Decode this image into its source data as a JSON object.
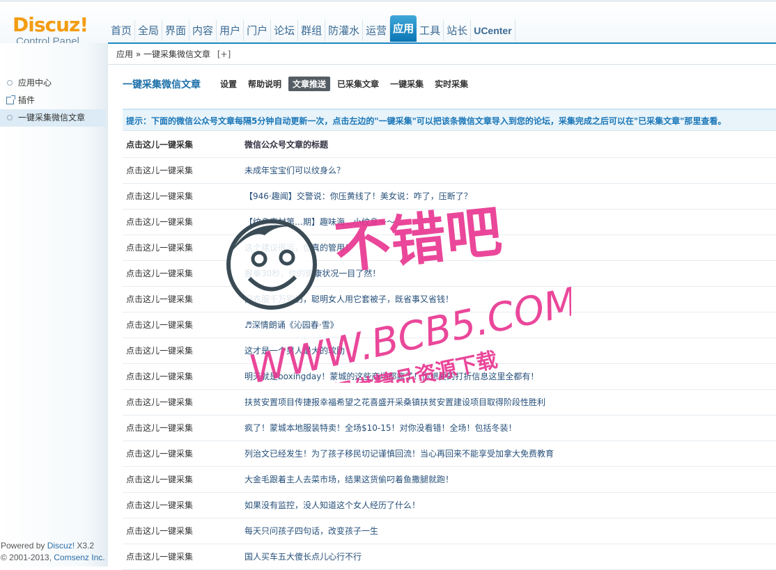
{
  "logo": {
    "main": "Discuz!",
    "sub": "Control Panel"
  },
  "topnav": [
    "首页",
    "全局",
    "界面",
    "内容",
    "用户",
    "门户",
    "论坛",
    "群组",
    "防灌水",
    "运营",
    "应用",
    "工具",
    "站长",
    "UCenter"
  ],
  "topnav_active": "应用",
  "sidebar": {
    "items": [
      "应用中心",
      "插件",
      "一键采集微信文章"
    ]
  },
  "breadcrumb": {
    "app": "应用",
    "sep": "»",
    "current": "一键采集微信文章",
    "add": "[+]"
  },
  "page": {
    "title": "一键采集微信文章"
  },
  "tabs": [
    "设置",
    "帮助说明",
    "文章推送",
    "已采集文章",
    "一键采集",
    "实时采集"
  ],
  "tab_active": "文章推送",
  "tip": "提示：下面的微信公众号文章每隔5分钟自动更新一次，点击左边的\"一键采集\"可以把该条微信文章导入到您的论坛，采集完成之后可以在\"已采集文章\"那里查看。",
  "table": {
    "headers": [
      "点击这儿一键采集",
      "微信公众号文章的标题"
    ],
    "rows": [
      {
        "action": "点击这儿一键采集",
        "title": "未成年宝宝们可以纹身么？"
      },
      {
        "action": "点击这儿一键采集",
        "title": "【946·趣闻】交警说：你压黄线了！美女说：咋了，压断了？"
      },
      {
        "action": "点击这儿一键采集",
        "title": "【纹身素材第…期】趣味海…小纹身～～"
      },
      {
        "action": "点击这儿一键采集",
        "title": "这个建议很污，但真的管用！"
      },
      {
        "action": "点击这儿一键采集",
        "title": "握拳30秒，你的健康状况一目了然！"
      },
      {
        "action": "点击这儿一键采集",
        "title": "旧衣服千万别扔，聪明女人用它套被子，既省事又省钱！"
      },
      {
        "action": "点击这儿一键采集",
        "title": "♬深情朗诵《沁园春·雪》"
      },
      {
        "action": "点击这儿一键采集",
        "title": "这才是一个男人最大的软肋"
      },
      {
        "action": "点击这儿一键采集",
        "title": "明天就是boxingday！蒙城的这些商场都疯了！你想要的打折信息这里全都有！"
      },
      {
        "action": "点击这儿一键采集",
        "title": "扶贫安置项目传捷报幸福希望之花喜盛开采桑镇扶贫安置建设项目取得阶段性胜利"
      },
      {
        "action": "点击这儿一键采集",
        "title": "疯了！蒙城本地服装特卖！全场$10-15！对你没看错！全场！包括冬装！"
      },
      {
        "action": "点击这儿一键采集",
        "title": "列治文已经发生！为了孩子移民切记谨慎回流！当心再回来不能享受加拿大免费教育"
      },
      {
        "action": "点击这儿一键采集",
        "title": "大金毛跟着主人去菜市场，结果这货偷叼着鱼撒腿就跑！"
      },
      {
        "action": "点击这儿一键采集",
        "title": "如果没有监控，没人知道这个女人经历了什么！"
      },
      {
        "action": "点击这儿一键采集",
        "title": "每天只问孩子四句话，改变孩子一生"
      },
      {
        "action": "点击这儿一键采集",
        "title": "国人买车五大傻长点儿心行不行"
      }
    ]
  },
  "footer": {
    "powered": "Powered by",
    "product": "Discuz!",
    "version": "X3.2",
    "copyright": "© 2001-2013,",
    "company": "Comsenz Inc."
  },
  "watermark": {
    "line1": "不错吧",
    "line2": "WWW.BCB5.COM",
    "line3": "免费提供精品资源下载"
  },
  "colors": {
    "accent": "#1b86c5",
    "logo": "#f39c12",
    "watermark": "#e8338f"
  }
}
